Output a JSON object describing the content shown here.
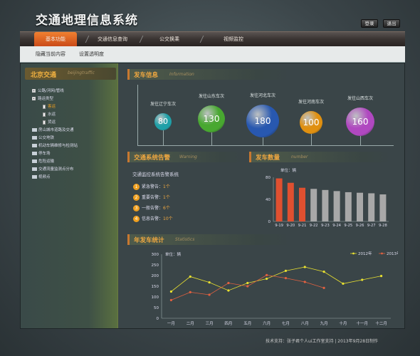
{
  "app_title": "交通地理信息系统",
  "top_buttons": {
    "login": "登录",
    "logout": "退出"
  },
  "nav": {
    "items": [
      "基本功能",
      "交通信息查询",
      "公交换乘",
      "视频监控"
    ]
  },
  "subbar": {
    "links": [
      "隐藏当前内容",
      "设置透明度"
    ]
  },
  "sidebar": {
    "title": "北京交通",
    "subtitle": "beijingtraffic",
    "tree": [
      {
        "label": "公路/河网/管线",
        "level": 0,
        "type": "box"
      },
      {
        "label": "路运类型",
        "level": 0,
        "type": "box"
      },
      {
        "label": "客运",
        "level": 1,
        "type": "doc",
        "active": true
      },
      {
        "label": "水运",
        "level": 1,
        "type": "doc"
      },
      {
        "label": "货运",
        "level": 1,
        "type": "doc"
      },
      {
        "label": "房山城市道路及交通",
        "level": 0,
        "type": "folder"
      },
      {
        "label": "公交地铁",
        "level": 0,
        "type": "folder"
      },
      {
        "label": "机动车辆维修与检测站",
        "level": 0,
        "type": "folder"
      },
      {
        "label": "停车场",
        "level": 0,
        "type": "folder"
      },
      {
        "label": "危险运输",
        "level": 0,
        "type": "folder"
      },
      {
        "label": "交通流量监测点分布",
        "level": 0,
        "type": "folder"
      },
      {
        "label": "视频点",
        "level": 0,
        "type": "folder"
      }
    ],
    "colors": {
      "active": "#f0a020"
    }
  },
  "departure_info": {
    "title": "发车信息",
    "subtitle": "Information",
    "balls": [
      {
        "caption": "发往辽宁车次",
        "value": "80",
        "color": "#20a0a8"
      },
      {
        "caption": "发往山东车次",
        "value": "130",
        "color": "#48a830"
      },
      {
        "caption": "发往河北车次",
        "value": "180",
        "color": "#2858b0"
      },
      {
        "caption": "发往河南车次",
        "value": "100",
        "color": "#e09010"
      },
      {
        "caption": "发往山西车次",
        "value": "160",
        "color": "#b048c0"
      }
    ]
  },
  "warning": {
    "title": "交通系统告警",
    "subtitle": "Warning",
    "heading": "交通监控系统告警系统",
    "items": [
      {
        "n": "1",
        "label": "紧急警告：",
        "count": "1个"
      },
      {
        "n": "2",
        "label": "重要告警：",
        "count": "1个"
      },
      {
        "n": "3",
        "label": "一般告警：",
        "count": "6个"
      },
      {
        "n": "4",
        "label": "信息告警：",
        "count": "10个"
      }
    ]
  },
  "chart_data": [
    {
      "type": "bar",
      "title": "发车数量",
      "subtitle": "number",
      "unit_label": "单位：辆",
      "categories": [
        "9-19",
        "9-20",
        "9-21",
        "9-22",
        "9-23",
        "9-24",
        "9-25",
        "9-26",
        "9-27",
        "9-28"
      ],
      "values": [
        78,
        70,
        61,
        59,
        57,
        55,
        53,
        52,
        51,
        49
      ],
      "highlight_count": 3,
      "ylim": [
        0,
        80
      ],
      "yticks": [
        0,
        40,
        80
      ],
      "colors": {
        "highlight": "#e05030",
        "normal": "#a8a8a8"
      }
    },
    {
      "type": "line",
      "title": "年发车统计",
      "subtitle": "Statistics",
      "unit_label": "单位：辆",
      "categories": [
        "一月",
        "二月",
        "三月",
        "四月",
        "五月",
        "六月",
        "七月",
        "八月",
        "九月",
        "十月",
        "十一月",
        "十二月"
      ],
      "ylim": [
        0,
        300
      ],
      "yticks": [
        0,
        50,
        100,
        150,
        200,
        250,
        300
      ],
      "series": [
        {
          "name": "2012年",
          "values": [
            125,
            195,
            168,
            130,
            165,
            185,
            222,
            240,
            218,
            162,
            180,
            198
          ],
          "color": "#e8e030"
        },
        {
          "name": "2013年",
          "values": [
            85,
            122,
            110,
            165,
            150,
            202,
            188,
            170,
            142,
            null,
            null,
            null
          ],
          "color": "#e06040"
        }
      ]
    }
  ],
  "footer": "技术支持：张子君个人ui工作室支持  |  2013年9月28日制作"
}
